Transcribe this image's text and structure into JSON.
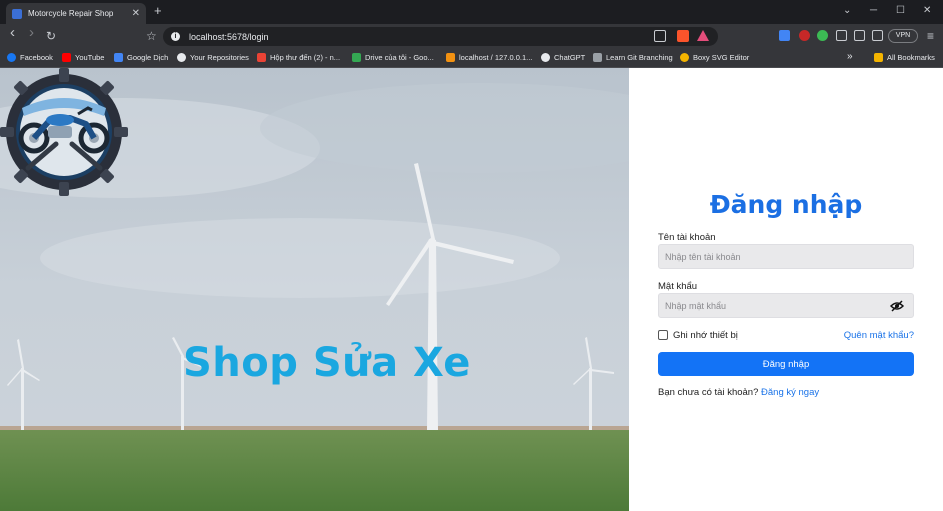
{
  "tab": {
    "title": "Motorcycle Repair Shop",
    "close": "✕",
    "new": "+"
  },
  "window": {
    "minimize": "─",
    "maximize": "☐",
    "close": "✕",
    "menu": "⌄"
  },
  "nav": {
    "back": "‹",
    "forward": "›",
    "reload": "↻",
    "bookmark_star": "☆"
  },
  "omnibox": {
    "url": "localhost:5678/login"
  },
  "toolbar": {
    "vpn": "VPN"
  },
  "bookmarks": [
    {
      "label": "Facebook",
      "color": "#1877f2"
    },
    {
      "label": "YouTube",
      "color": "#ff0000"
    },
    {
      "label": "Google Dịch",
      "color": "#4285f4"
    },
    {
      "label": "Your Repositories",
      "color": "#e8eaed"
    },
    {
      "label": "Hộp thư đến (2) - n...",
      "color": "#ea4335"
    },
    {
      "label": "Drive của tôi - Goo...",
      "color": "#34a853"
    },
    {
      "label": "localhost / 127.0.0.1...",
      "color": "#f29111"
    },
    {
      "label": "ChatGPT",
      "color": "#e8eaed"
    },
    {
      "label": "Learn Git Branching",
      "color": "#9aa0a6"
    },
    {
      "label": "Boxy SVG Editor",
      "color": "#f4b400"
    }
  ],
  "bookmarks_more": "»",
  "all_bookmarks": "All Bookmarks",
  "brand": {
    "name": "Shop Sửa Xe"
  },
  "login": {
    "title": "Đăng nhập",
    "username_label": "Tên tài khoản",
    "username_placeholder": "Nhập tên tài khoản",
    "password_label": "Mật khẩu",
    "password_placeholder": "Nhập mật khẩu",
    "remember": "Ghi nhớ thiết bị",
    "forgot": "Quên mật khẩu?",
    "submit": "Đăng nhập",
    "no_account": "Bạn chưa có tài khoản?",
    "signup": "Đăng ký ngay"
  },
  "colors": {
    "accent": "#1373f6",
    "brand": "#1aa7e0",
    "title": "#1b6fe3"
  }
}
